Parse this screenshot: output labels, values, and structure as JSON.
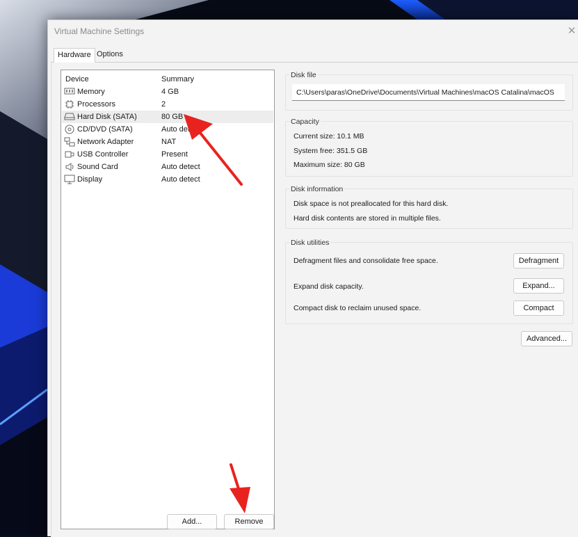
{
  "window": {
    "title": "Virtual Machine Settings",
    "close_glyph": "✕"
  },
  "tabs": [
    {
      "label": "Hardware",
      "active": true
    },
    {
      "label": "Options",
      "active": false
    }
  ],
  "device_list": {
    "header_device": "Device",
    "header_summary": "Summary",
    "items": [
      {
        "icon": "memory-icon",
        "name": "Memory",
        "summary": "4 GB",
        "selected": false
      },
      {
        "icon": "processor-icon",
        "name": "Processors",
        "summary": "2",
        "selected": false
      },
      {
        "icon": "hard-disk-icon",
        "name": "Hard Disk (SATA)",
        "summary": "80 GB",
        "selected": true
      },
      {
        "icon": "cd-dvd-icon",
        "name": "CD/DVD (SATA)",
        "summary": "Auto detect",
        "selected": false
      },
      {
        "icon": "network-adapter-icon",
        "name": "Network Adapter",
        "summary": "NAT",
        "selected": false
      },
      {
        "icon": "usb-icon",
        "name": "USB Controller",
        "summary": "Present",
        "selected": false
      },
      {
        "icon": "sound-card-icon",
        "name": "Sound Card",
        "summary": "Auto detect",
        "selected": false
      },
      {
        "icon": "display-icon",
        "name": "Display",
        "summary": "Auto detect",
        "selected": false
      }
    ],
    "add_label": "Add...",
    "remove_label": "Remove"
  },
  "disk_file": {
    "label": "Disk file",
    "path": "C:\\Users\\paras\\OneDrive\\Documents\\Virtual Machines\\macOS Catalina\\macOS"
  },
  "capacity": {
    "label": "Capacity",
    "current_size": "Current size: 10.1 MB",
    "system_free": "System free: 351.5 GB",
    "maximum_size": "Maximum size: 80 GB"
  },
  "disk_information": {
    "label": "Disk information",
    "line1": "Disk space is not preallocated for this hard disk.",
    "line2": "Hard disk contents are stored in multiple files."
  },
  "disk_utilities": {
    "label": "Disk utilities",
    "defragment_text": "Defragment files and consolidate free space.",
    "defragment_label": "Defragment",
    "expand_text": "Expand disk capacity.",
    "expand_label": "Expand...",
    "compact_text": "Compact disk to reclaim unused space.",
    "compact_label": "Compact"
  },
  "advanced_label": "Advanced...",
  "colors": {
    "annotation_arrow": "#e8231f",
    "window_bg": "#f3f3f3",
    "selection": "#ededed"
  }
}
